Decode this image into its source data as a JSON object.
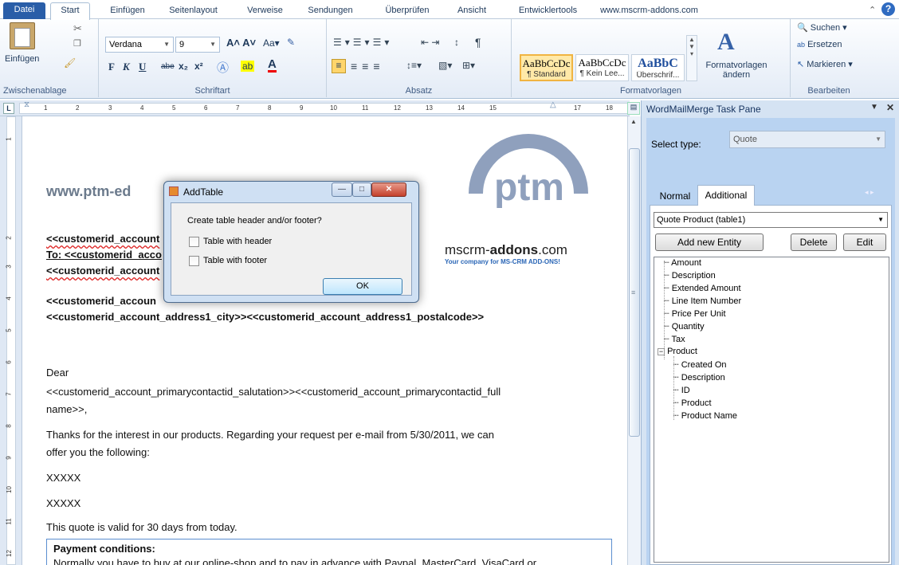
{
  "tabs": {
    "file": "Datei",
    "items": [
      "Start",
      "Einfügen",
      "Seitenlayout",
      "Verweise",
      "Sendungen",
      "Überprüfen",
      "Ansicht",
      "Entwicklertools",
      "www.mscrm-addons.com"
    ]
  },
  "ribbon": {
    "clipboard": {
      "paste": "Einfügen",
      "label": "Zwischenablage"
    },
    "font": {
      "name": "Verdana",
      "size": "9",
      "bold": "F",
      "italic": "K",
      "underline": "U",
      "strike": "abe",
      "sub": "x₂",
      "sup": "x²",
      "label": "Schriftart"
    },
    "paragraph": {
      "label": "Absatz"
    },
    "styles": {
      "items": [
        {
          "preview": "AaBbCcDc",
          "name": "¶ Standard"
        },
        {
          "preview": "AaBbCcDc",
          "name": "¶ Kein Lee..."
        },
        {
          "preview": "AaBbC",
          "name": "Überschrif..."
        }
      ],
      "change": "Formatvorlagen ändern",
      "label": "Formatvorlagen"
    },
    "editing": {
      "find": "Suchen",
      "replace": "Ersetzen",
      "select": "Markieren",
      "label": "Bearbeiten"
    }
  },
  "ruler": {
    "numbers": [
      "1",
      "2",
      "3",
      "4",
      "5",
      "6",
      "7",
      "8",
      "9",
      "10",
      "11",
      "12",
      "13",
      "14",
      "15",
      "17",
      "18"
    ]
  },
  "vruler": {
    "numbers": [
      "1",
      "2",
      "3",
      "4",
      "5",
      "6",
      "7",
      "8",
      "9",
      "10",
      "11",
      "12"
    ]
  },
  "document": {
    "website": "www.ptm-ed",
    "logo": "ptm",
    "brand": {
      "prefix": "mscrm-",
      "strong": "addons",
      "suffix": ".com",
      "tagline": "Your company for MS-CRM ADD-ONS!"
    },
    "line1": "<<customerid_account",
    "line2_prefix": "To: ",
    "line2": "<<customerid_acco",
    "line3": "<<customerid_account",
    "line4": "<<customerid_accoun",
    "line5": "<<customerid_account_address1_city>><<customerid_account_address1_postalcode>>",
    "dear": "Dear",
    "salutation1": "<<customerid_account_primarycontactid_salutation>><<customerid_account_primarycontactid_full",
    "salutation2": "name>>,",
    "body1": "Thanks for the interest in our products. Regarding your request per e-mail from 5/30/2011, we can",
    "body2": "offer you the following:",
    "x1": "XXXXX",
    "x2": "XXXXX",
    "valid": "This quote is valid for 30 days from today.",
    "payment_title": "Payment conditions:",
    "payment_text": "Normally you have to buy at our online-shop and to pay in advance with Paypal, MasterCard, VisaCard or"
  },
  "dialog": {
    "title": "AddTable",
    "question": "Create table header and/or footer?",
    "header_option": "Table with header",
    "footer_option": "Table with footer",
    "ok": "OK"
  },
  "pane": {
    "title": "WordMailMerge Task Pane",
    "select_type_label": "Select type:",
    "select_type_value": "Quote",
    "tab_normal": "Normal",
    "tab_additional": "Additional",
    "entity_value": "Quote Product  (table1)",
    "add_entity": "Add new Entity",
    "delete": "Delete",
    "edit": "Edit",
    "tree": [
      "Amount",
      "Description",
      "Extended Amount",
      "Line Item Number",
      "Price Per Unit",
      "Quantity",
      "Tax",
      "Product"
    ],
    "product_children": [
      "Created On",
      "Description",
      "ID",
      "Product",
      "Product Name"
    ]
  }
}
